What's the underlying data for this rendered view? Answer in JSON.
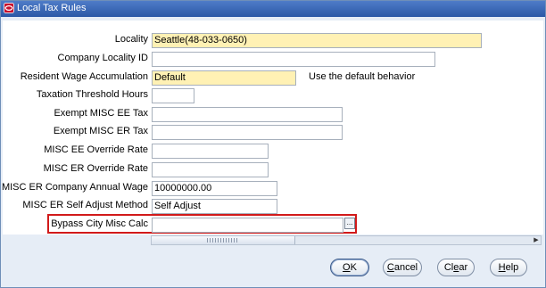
{
  "window": {
    "title": "Local Tax Rules",
    "accent": "#2b58a6"
  },
  "fields": [
    {
      "label": "Locality",
      "value": "Seattle(48-033-0650)",
      "required": true
    },
    {
      "label": "Company Locality ID",
      "value": ""
    },
    {
      "label": "Resident Wage Accumulation",
      "value": "Default",
      "required": true,
      "hint": "Use the default behavior"
    },
    {
      "label": "Taxation Threshold Hours",
      "value": ""
    },
    {
      "label": "Exempt MISC EE Tax",
      "value": ""
    },
    {
      "label": "Exempt MISC ER Tax",
      "value": ""
    },
    {
      "label": "MISC EE Override Rate",
      "value": ""
    },
    {
      "label": "MISC ER Override Rate",
      "value": ""
    },
    {
      "label": "MISC ER Company Annual Wage",
      "value": "10000000.00"
    },
    {
      "label": "MISC ER Self Adjust Method",
      "value": "Self Adjust"
    },
    {
      "label": "Bypass City Misc Calc",
      "value": ""
    }
  ],
  "lov_button": "...",
  "buttons": {
    "ok": {
      "mnemonic": "O",
      "rest": "K"
    },
    "cancel": {
      "mnemonic": "C",
      "rest": "ancel"
    },
    "clear": {
      "pre": "Cl",
      "mnemonic": "e",
      "rest": "ar"
    },
    "help": {
      "mnemonic": "H",
      "rest": "elp"
    }
  }
}
